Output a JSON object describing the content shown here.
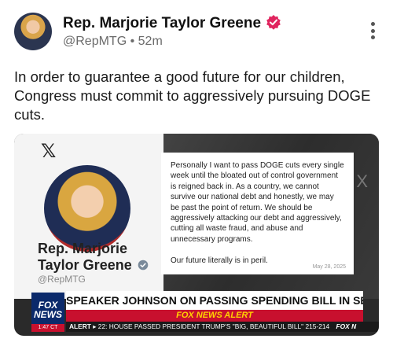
{
  "post": {
    "display_name": "Rep. Marjorie Taylor Greene",
    "handle": "@RepMTG",
    "separator": "•",
    "time": "52m",
    "text": "In order to guarantee a good future for our children, Congress must commit to aggressively pursuing DOGE cuts.",
    "verified_color": "#e0245e"
  },
  "media": {
    "x_logo": "𝕏",
    "profile_name": "Rep. Marjorie Taylor Greene",
    "profile_handle": "@RepMTG",
    "quote_text": "Personally I want to pass DOGE cuts every single week until the bloated out of control government is reigned back in. As a country, we cannot survive our national debt and honestly, we may be past the point of return. We should be aggressively attacking our debt and aggressively, cutting all waste fraud, and abuse and unnecessary programs.\n\nOur future literally is in peril.",
    "quote_date": "May 28, 2025",
    "ghost_x": "X"
  },
  "broadcast": {
    "logo_line1": "FOX",
    "logo_line2": "NEWS",
    "clock": "1:47 CT",
    "headline": "SPEAKER JOHNSON ON PASSING SPENDING BILL IN SENATE",
    "alert": "FOX NEWS ALERT",
    "ticker_tag": "ALERT ▸",
    "ticker_text": "22: HOUSE PASSED PRESIDENT TRUMP'S \"BIG, BEAUTIFUL BILL\" 215-214",
    "ticker_brand": "FOX N"
  }
}
